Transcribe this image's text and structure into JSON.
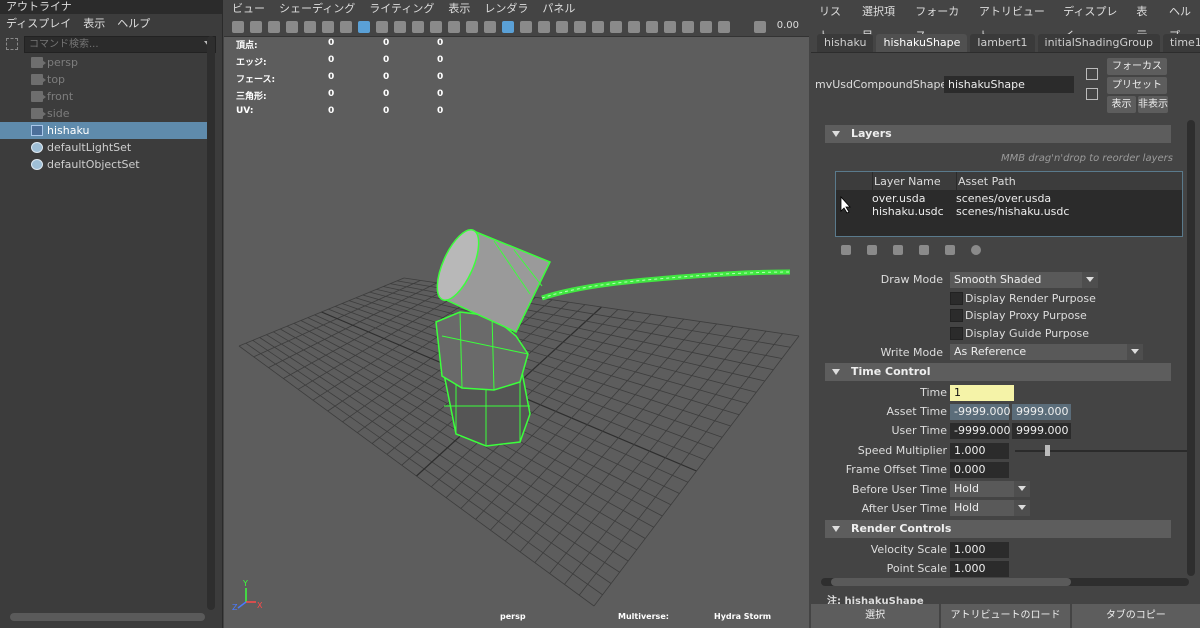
{
  "outliner": {
    "title": "アウトライナ",
    "menu": [
      "ディスプレイ",
      "表示",
      "ヘルプ"
    ],
    "search_placeholder": "コマンド検索...",
    "items": [
      {
        "label": "persp",
        "icon": "camera-icon",
        "dim": true
      },
      {
        "label": "top",
        "icon": "camera-icon",
        "dim": true
      },
      {
        "label": "front",
        "icon": "camera-icon",
        "dim": true
      },
      {
        "label": "side",
        "icon": "camera-icon",
        "dim": true
      },
      {
        "label": "hishaku",
        "icon": "usd-shape-icon",
        "selected": true
      },
      {
        "label": "defaultLightSet",
        "icon": "set-icon"
      },
      {
        "label": "defaultObjectSet",
        "icon": "set-icon"
      }
    ]
  },
  "viewport": {
    "menu": [
      "ビュー",
      "シェーディング",
      "ライティング",
      "表示",
      "レンダラ",
      "パネル"
    ],
    "toolbar_value": "0.00",
    "hud": [
      {
        "label": "頂点:",
        "values": [
          "0",
          "0",
          "0"
        ]
      },
      {
        "label": "エッジ:",
        "values": [
          "0",
          "0",
          "0"
        ]
      },
      {
        "label": "フェース:",
        "values": [
          "0",
          "0",
          "0"
        ]
      },
      {
        "label": "三角形:",
        "values": [
          "0",
          "0",
          "0"
        ]
      },
      {
        "label": "UV:",
        "values": [
          "0",
          "0",
          "0"
        ]
      }
    ],
    "camera": "persp",
    "plugin": "Multiverse:",
    "renderer": "Hydra Storm",
    "axis": {
      "x": "X",
      "y": "Y",
      "z": "Z"
    },
    "colors": {
      "wire": "#3cff3c",
      "grid": "#3d3d3d",
      "bg": "#5d5d5d"
    }
  },
  "attr": {
    "menu": [
      "リスト",
      "選択項目",
      "フォーカス",
      "アトリビュート",
      "ディスプレイ",
      "表示",
      "ヘルプ"
    ],
    "tabs": [
      "hishaku",
      "hishakuShape",
      "lambert1",
      "initialShadingGroup",
      "time1"
    ],
    "active_tab": 1,
    "node_label": "mvUsdCompoundShape:",
    "node_value": "hishakuShape",
    "focus_button": "フォーカス",
    "preset_button": "プリセット",
    "show_button": "表示",
    "hide_button": "非表示",
    "layers": {
      "header": "Layers",
      "hint": "MMB drag'n'drop to reorder layers",
      "col_name": "Layer Name",
      "col_path": "Asset Path",
      "rows": [
        {
          "name": "over.usda",
          "path": "scenes/over.usda"
        },
        {
          "name": "hishaku.usdc",
          "path": "scenes/hishaku.usdc"
        }
      ]
    },
    "draw_mode_label": "Draw Mode",
    "draw_mode_value": "Smooth Shaded",
    "purpose": [
      "Display Render Purpose",
      "Display Proxy Purpose",
      "Display Guide Purpose"
    ],
    "write_mode_label": "Write Mode",
    "write_mode_value": "As Reference",
    "time_control": {
      "header": "Time Control",
      "time_label": "Time",
      "time_value": "1",
      "asset_time_label": "Asset Time",
      "asset_time_min": "-9999.000",
      "asset_time_max": "9999.000",
      "user_time_label": "User Time",
      "user_time_min": "-9999.000",
      "user_time_max": "9999.000",
      "speed_label": "Speed Multiplier",
      "speed_value": "1.000",
      "offset_label": "Frame Offset Time",
      "offset_value": "0.000",
      "before_label": "Before User Time",
      "before_value": "Hold",
      "after_label": "After User Time",
      "after_value": "Hold"
    },
    "render_controls": {
      "header": "Render Controls",
      "velocity_label": "Velocity Scale",
      "velocity_value": "1.000",
      "point_label": "Point Scale",
      "point_value": "1.000"
    },
    "notes_label": "注: hishakuShape",
    "bottom": [
      "選択",
      "アトリビュートのロード",
      "タブのコピー"
    ]
  }
}
